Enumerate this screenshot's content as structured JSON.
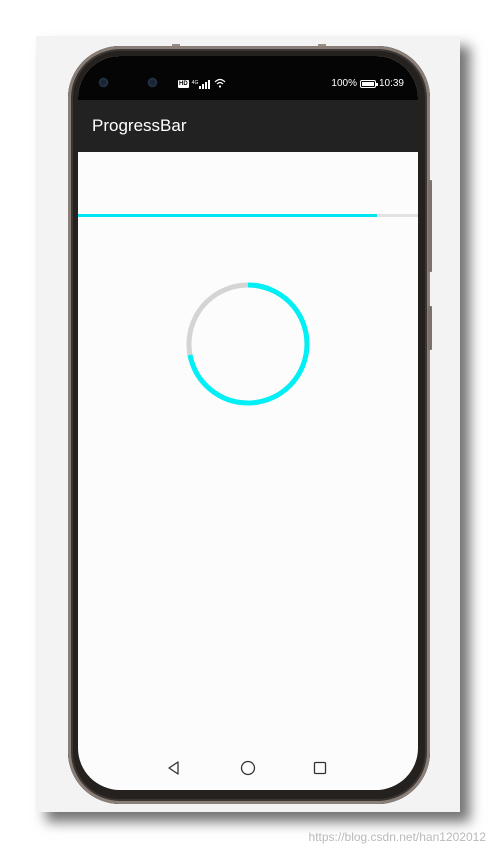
{
  "status_bar": {
    "network_badge": "HD",
    "network_type": "4G",
    "battery_percent": "100%",
    "battery_level": 1.0,
    "time": "10:39",
    "icons": [
      "camera-icon",
      "camera-icon",
      "hd-icon",
      "signal-icon",
      "wifi-icon",
      "battery-icon"
    ]
  },
  "app_bar": {
    "title": "ProgressBar"
  },
  "horizontal_progress": {
    "progress_fraction": 0.88,
    "color": "#00e5f0",
    "track_color": "#e2e2e2"
  },
  "circular_progress": {
    "progress_fraction": 0.72,
    "color": "#00f0f5",
    "track_color": "#d4d4d4"
  },
  "nav_bar": {
    "icons": [
      "back-icon",
      "home-icon",
      "recents-icon"
    ]
  },
  "watermark": "https://blog.csdn.net/han1202012"
}
